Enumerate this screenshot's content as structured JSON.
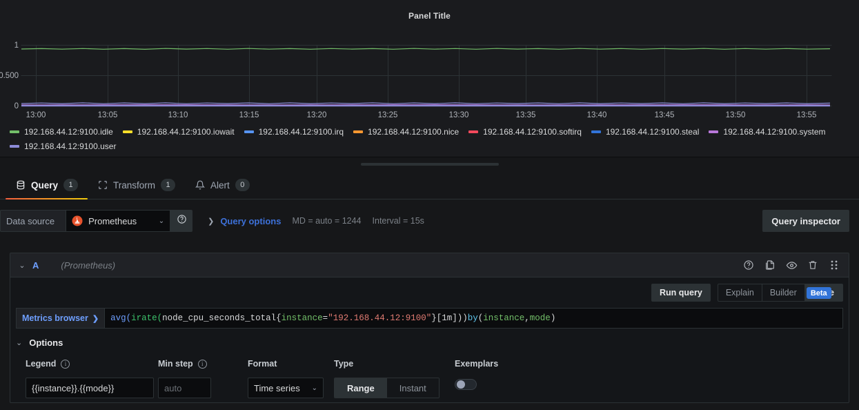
{
  "panel": {
    "title": "Panel Title",
    "y_axis_labels": [
      "1",
      "0.500",
      "0"
    ],
    "x_axis_labels": [
      "13:00",
      "13:05",
      "13:10",
      "13:15",
      "13:20",
      "13:25",
      "13:30",
      "13:35",
      "13:40",
      "13:45",
      "13:50",
      "13:55"
    ],
    "legend": [
      {
        "label": "192.168.44.12:9100.idle",
        "color": "#73BF69"
      },
      {
        "label": "192.168.44.12:9100.iowait",
        "color": "#FADE2A"
      },
      {
        "label": "192.168.44.12:9100.irq",
        "color": "#5794F2"
      },
      {
        "label": "192.168.44.12:9100.nice",
        "color": "#FF9830"
      },
      {
        "label": "192.168.44.12:9100.softirq",
        "color": "#F2495C"
      },
      {
        "label": "192.168.44.12:9100.steal",
        "color": "#3274D9"
      },
      {
        "label": "192.168.44.12:9100.system",
        "color": "#B877D9"
      },
      {
        "label": "192.168.44.12:9100.user",
        "color": "#8C8BD8"
      }
    ]
  },
  "chart_data": {
    "type": "line",
    "title": "Panel Title",
    "xlabel": "",
    "ylabel": "",
    "ylim": [
      0,
      1.05
    ],
    "grid": true,
    "legend_position": "bottom",
    "x": [
      "13:00",
      "13:05",
      "13:10",
      "13:15",
      "13:20",
      "13:25",
      "13:30",
      "13:35",
      "13:40",
      "13:45",
      "13:50",
      "13:55"
    ],
    "series": [
      {
        "name": "192.168.44.12:9100.idle",
        "color": "#73BF69",
        "values": [
          0.93,
          0.935,
          0.93,
          0.935,
          0.94,
          0.93,
          0.935,
          0.94,
          0.93,
          0.935,
          0.94,
          0.935
        ]
      },
      {
        "name": "192.168.44.12:9100.iowait",
        "color": "#FADE2A",
        "values": [
          0.002,
          0.002,
          0.002,
          0.002,
          0.002,
          0.002,
          0.002,
          0.002,
          0.002,
          0.002,
          0.002,
          0.002
        ]
      },
      {
        "name": "192.168.44.12:9100.irq",
        "color": "#5794F2",
        "values": [
          0,
          0,
          0,
          0,
          0,
          0,
          0,
          0,
          0,
          0,
          0,
          0
        ]
      },
      {
        "name": "192.168.44.12:9100.nice",
        "color": "#FF9830",
        "values": [
          0,
          0,
          0,
          0,
          0,
          0,
          0,
          0,
          0,
          0,
          0,
          0
        ]
      },
      {
        "name": "192.168.44.12:9100.softirq",
        "color": "#F2495C",
        "values": [
          0.002,
          0.002,
          0.002,
          0.002,
          0.002,
          0.002,
          0.002,
          0.002,
          0.002,
          0.002,
          0.002,
          0.002
        ]
      },
      {
        "name": "192.168.44.12:9100.steal",
        "color": "#3274D9",
        "values": [
          0,
          0,
          0,
          0,
          0,
          0,
          0,
          0,
          0,
          0,
          0,
          0
        ]
      },
      {
        "name": "192.168.44.12:9100.system",
        "color": "#B877D9",
        "values": [
          0.012,
          0.013,
          0.012,
          0.013,
          0.012,
          0.013,
          0.012,
          0.013,
          0.012,
          0.013,
          0.012,
          0.013
        ]
      },
      {
        "name": "192.168.44.12:9100.user",
        "color": "#8C8BD8",
        "values": [
          0.04,
          0.042,
          0.04,
          0.043,
          0.041,
          0.04,
          0.043,
          0.041,
          0.04,
          0.042,
          0.041,
          0.04
        ]
      }
    ]
  },
  "tabs": [
    {
      "label": "Query",
      "badge": "1",
      "icon": "database-icon",
      "active": true
    },
    {
      "label": "Transform",
      "badge": "1",
      "icon": "transform-icon",
      "active": false
    },
    {
      "label": "Alert",
      "badge": "0",
      "icon": "bell-icon",
      "active": false
    }
  ],
  "datasource_row": {
    "label": "Data source",
    "selected": "Prometheus",
    "help_icon": "question-circle-icon",
    "query_options_label": "Query options",
    "max_data_points": "MD = auto = 1244",
    "interval": "Interval = 15s",
    "query_inspector_label": "Query inspector"
  },
  "query": {
    "ref_id": "A",
    "datasource_name": "(Prometheus)",
    "actions": [
      "help-circle-icon",
      "duplicate-icon",
      "eye-icon",
      "trash-icon",
      "drag-handle-icon"
    ],
    "run_query_label": "Run query",
    "modes": [
      {
        "label": "Explain",
        "selected": false
      },
      {
        "label": "Builder",
        "selected": false,
        "badge": "Beta"
      },
      {
        "label": "Code",
        "selected": true
      }
    ],
    "metrics_browser_label": "Metrics browser",
    "expression": {
      "full": "avg(irate(node_cpu_seconds_total{instance=\"192.168.44.12:9100\"}[1m])) by (instance,mode)",
      "tokens": [
        {
          "text": "avg(",
          "type": "func"
        },
        {
          "text": "irate(",
          "type": "func2"
        },
        {
          "text": "node_cpu_seconds_total{",
          "type": "plain"
        },
        {
          "text": "instance",
          "type": "label"
        },
        {
          "text": "=",
          "type": "plain"
        },
        {
          "text": "\"192.168.44.12:9100\"",
          "type": "string"
        },
        {
          "text": "}[1m])) ",
          "type": "plain"
        },
        {
          "text": "by ",
          "type": "kw"
        },
        {
          "text": "(",
          "type": "plain"
        },
        {
          "text": "instance",
          "type": "label"
        },
        {
          "text": ",",
          "type": "plain"
        },
        {
          "text": "mode",
          "type": "label"
        },
        {
          "text": ")",
          "type": "plain"
        }
      ]
    },
    "options": {
      "title": "Options",
      "legend": {
        "label": "Legend",
        "value": "{{instance}}.{{mode}}"
      },
      "min_step": {
        "label": "Min step",
        "value": "",
        "placeholder": "auto"
      },
      "format": {
        "label": "Format",
        "value": "Time series"
      },
      "type": {
        "label": "Type",
        "options": [
          "Range",
          "Instant"
        ],
        "selected": "Range"
      },
      "exemplars": {
        "label": "Exemplars",
        "enabled": false
      }
    }
  },
  "colors": {
    "accent_blue": "#6e9fff",
    "tab_underline": "#f55f3e",
    "beta_badge": "#3274d9",
    "prometheus_red": "#e6522c"
  }
}
